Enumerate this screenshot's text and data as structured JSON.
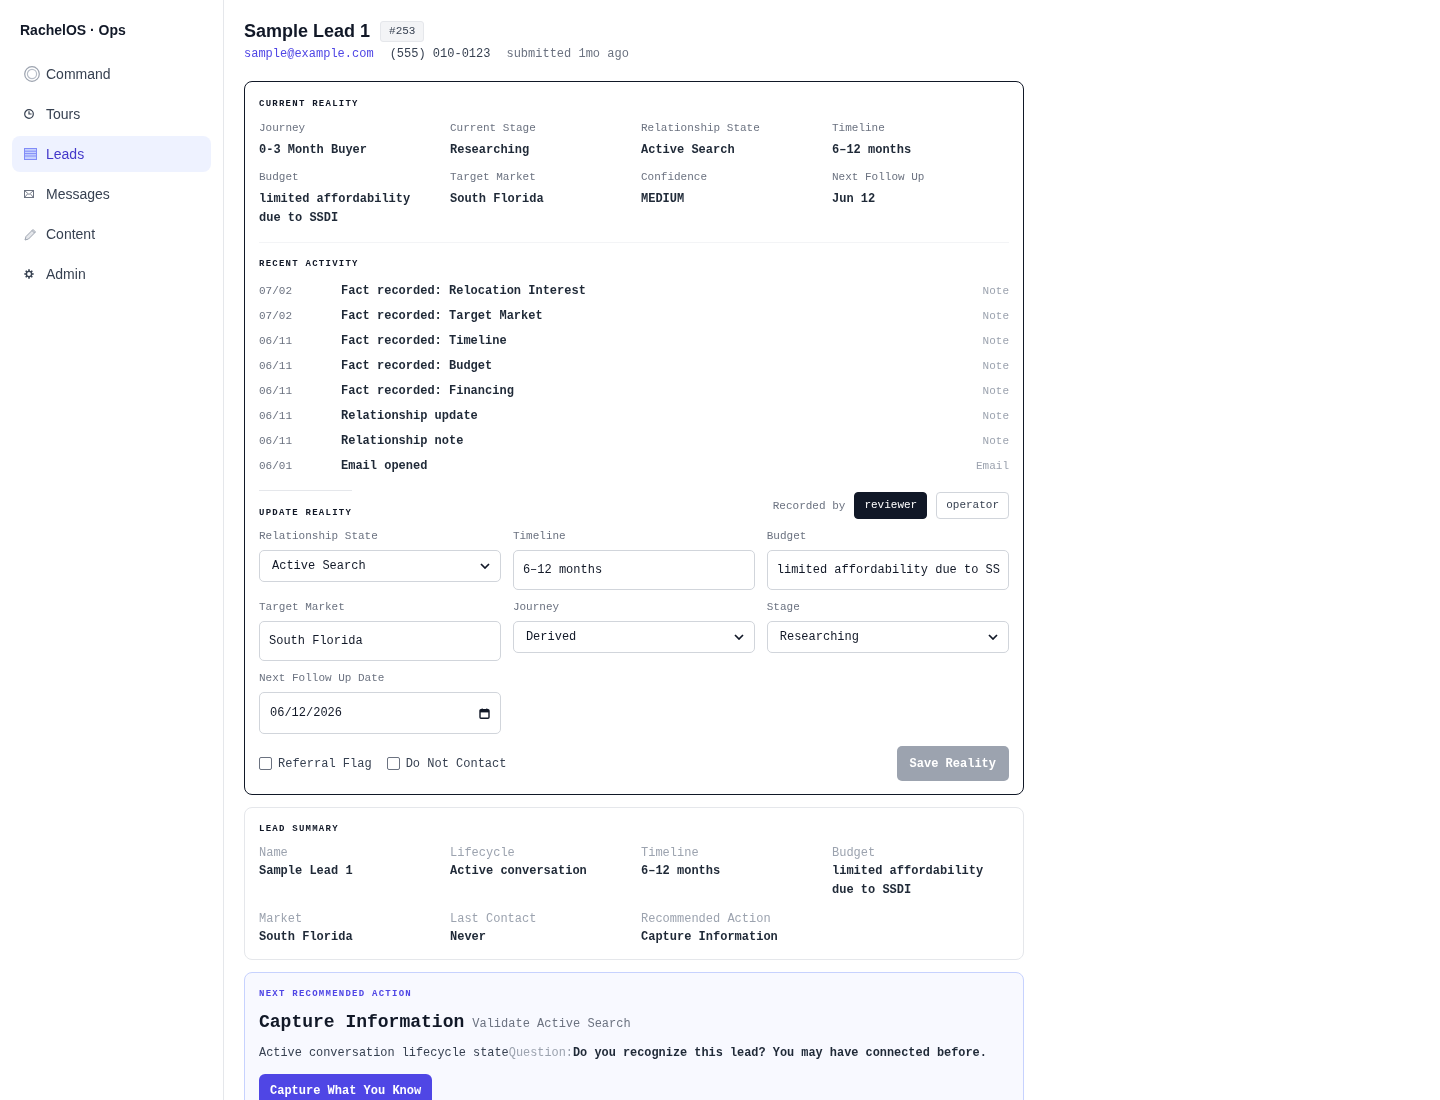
{
  "sidebar": {
    "brand": "RachelOS · Ops",
    "items": [
      {
        "label": "Command",
        "selected": false
      },
      {
        "label": "Tours",
        "selected": false
      },
      {
        "label": "Leads",
        "selected": true
      },
      {
        "label": "Messages",
        "selected": false
      },
      {
        "label": "Content",
        "selected": false
      },
      {
        "label": "Admin",
        "selected": false
      }
    ]
  },
  "lead": {
    "name": "Sample Lead 1",
    "id_badge": "#253",
    "email": "sample@example.com",
    "phone": "(555) 010-0123",
    "submitted": "submitted 1mo ago"
  },
  "current_reality": {
    "title": "CURRENT REALITY",
    "fields": [
      {
        "label": "Journey",
        "value": "0-3 Month Buyer"
      },
      {
        "label": "Current Stage",
        "value": "Researching"
      },
      {
        "label": "Relationship State",
        "value": "Active Search"
      },
      {
        "label": "Timeline",
        "value": "6–12 months"
      },
      {
        "label": "Budget",
        "value": "limited affordability due to SSDI"
      },
      {
        "label": "Target Market",
        "value": "South Florida"
      },
      {
        "label": "Confidence",
        "value": "MEDIUM"
      },
      {
        "label": "Next Follow Up",
        "value": "Jun 12"
      }
    ]
  },
  "recent_activity": {
    "title": "RECENT ACTIVITY",
    "rows": [
      {
        "date": "07/02",
        "text": "Fact recorded: Relocation Interest",
        "type": "Note"
      },
      {
        "date": "07/02",
        "text": "Fact recorded: Target Market",
        "type": "Note"
      },
      {
        "date": "06/11",
        "text": "Fact recorded: Timeline",
        "type": "Note"
      },
      {
        "date": "06/11",
        "text": "Fact recorded: Budget",
        "type": "Note"
      },
      {
        "date": "06/11",
        "text": "Fact recorded: Financing",
        "type": "Note"
      },
      {
        "date": "06/11",
        "text": "Relationship update",
        "type": "Note"
      },
      {
        "date": "06/11",
        "text": "Relationship note",
        "type": "Note"
      },
      {
        "date": "06/01",
        "text": "Email opened",
        "type": "Email"
      }
    ]
  },
  "update_reality": {
    "title": "UPDATE REALITY",
    "recorded_by_label": "Recorded by",
    "recorded_by": [
      {
        "label": "reviewer",
        "selected": true
      },
      {
        "label": "operator",
        "selected": false
      }
    ],
    "fields": [
      {
        "kind": "select",
        "label": "Relationship State",
        "value": "Active Search"
      },
      {
        "kind": "input",
        "label": "Timeline",
        "value": "6–12 months"
      },
      {
        "kind": "input",
        "label": "Budget",
        "value": "limited affordability due to SS"
      },
      {
        "kind": "input",
        "label": "Target Market",
        "value": "South Florida"
      },
      {
        "kind": "select",
        "label": "Journey",
        "value": "Derived"
      },
      {
        "kind": "select",
        "label": "Stage",
        "value": "Researching"
      },
      {
        "kind": "date",
        "label": "Next Follow Up Date",
        "value": "06/12/2026"
      }
    ],
    "checkboxes": [
      {
        "label": "Referral Flag",
        "checked": false
      },
      {
        "label": "Do Not Contact",
        "checked": false
      }
    ],
    "save_button": {
      "label": "Save Reality",
      "disabled": true
    }
  },
  "lead_summary": {
    "title": "LEAD SUMMARY",
    "fields": [
      {
        "label": "Name",
        "value": "Sample Lead 1"
      },
      {
        "label": "Lifecycle",
        "value": "Active conversation"
      },
      {
        "label": "Timeline",
        "value": "6–12 months"
      },
      {
        "label": "Budget",
        "value": "limited affordability due to SSDI"
      },
      {
        "label": "Market",
        "value": "South Florida"
      },
      {
        "label": "Last Contact",
        "value": "Never"
      },
      {
        "label": "Recommended Action",
        "value": "Capture Information"
      }
    ]
  },
  "next_action": {
    "title": "NEXT RECOMMENDED ACTION",
    "headline": "Capture Information",
    "subtitle": "Validate Active Search",
    "note": "Active conversation lifecycle state",
    "question_label": "Question:",
    "question": "Do you recognize this lead? You may have connected before.",
    "button": "Capture What You Know"
  }
}
